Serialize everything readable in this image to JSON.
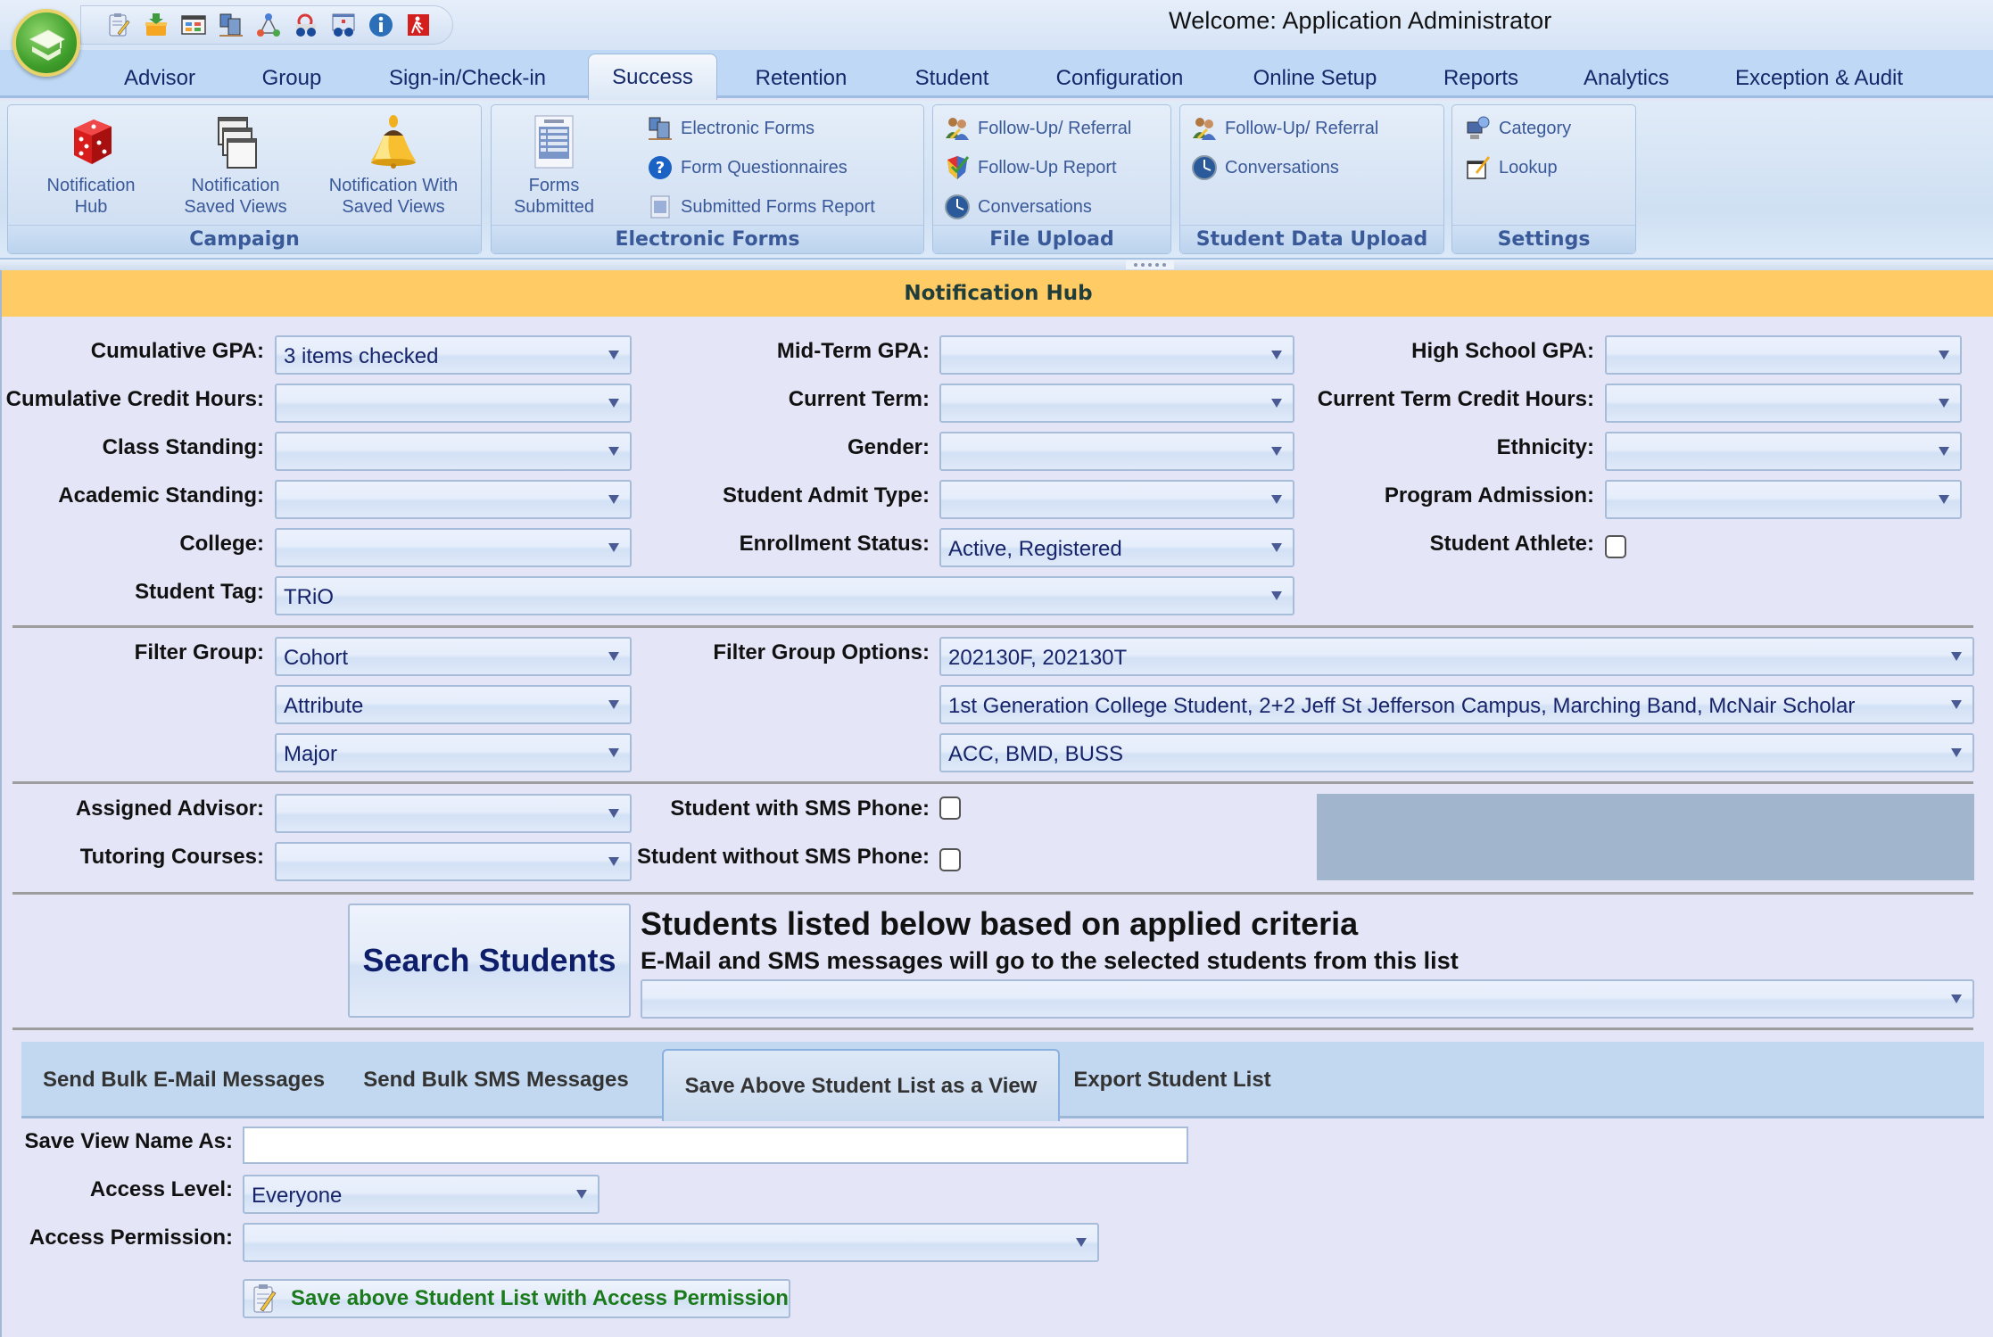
{
  "window": {
    "welcome_text": "Welcome: Application Administrator"
  },
  "quick_access": [
    {
      "icon": "notepad-edit-icon"
    },
    {
      "icon": "basket-download-icon"
    },
    {
      "icon": "dashboard-window-icon"
    },
    {
      "icon": "computer-backup-icon"
    },
    {
      "icon": "network-triangle-icon"
    },
    {
      "icon": "email-binoculars-icon"
    },
    {
      "icon": "table-binoculars-icon"
    },
    {
      "icon": "info-icon"
    },
    {
      "icon": "exit-icon"
    }
  ],
  "ribbon_tabs": [
    {
      "label": "Advisor"
    },
    {
      "label": "Group"
    },
    {
      "label": "Sign-in/Check-in"
    },
    {
      "label": "Success",
      "active": true
    },
    {
      "label": "Retention"
    },
    {
      "label": "Student"
    },
    {
      "label": "Configuration"
    },
    {
      "label": "Online Setup"
    },
    {
      "label": "Reports"
    },
    {
      "label": "Analytics"
    },
    {
      "label": "Exception & Audit"
    }
  ],
  "ribbon_groups": {
    "campaign": {
      "title": "Campaign",
      "buttons": [
        {
          "line1": "Notification",
          "line2": "Hub",
          "icon": "red-dice-icon"
        },
        {
          "line1": "Notification",
          "line2": "Saved Views",
          "icon": "stacked-windows-icon"
        },
        {
          "line1": "Notification With",
          "line2": "Saved Views",
          "icon": "bell-icon"
        }
      ]
    },
    "electronic_forms": {
      "title": "Electronic Forms",
      "big_button": {
        "line1": "Forms",
        "line2": "Submitted",
        "icon": "form-sheet-icon"
      },
      "items": [
        {
          "label": "Electronic Forms",
          "icon": "computer-backup-icon"
        },
        {
          "label": "Form Questionnaires",
          "icon": "help-question-icon"
        },
        {
          "label": "Submitted Forms Report",
          "icon": "report-sheet-icon"
        }
      ]
    },
    "file_upload": {
      "title": "File Upload",
      "items": [
        {
          "label": "Follow-Up/ Referral",
          "icon": "users-referral-icon"
        },
        {
          "label": "Follow-Up Report",
          "icon": "shield-check-icon"
        },
        {
          "label": "Conversations",
          "icon": "clock-icon"
        }
      ]
    },
    "student_data_upload": {
      "title": "Student Data Upload",
      "items": [
        {
          "label": "Follow-Up/ Referral",
          "icon": "users-referral-icon"
        },
        {
          "label": "Conversations",
          "icon": "clock-icon"
        }
      ]
    },
    "settings": {
      "title": "Settings",
      "items": [
        {
          "label": "Category",
          "icon": "category-computer-icon"
        },
        {
          "label": "Lookup",
          "icon": "lookup-edit-icon"
        }
      ]
    }
  },
  "page": {
    "header": "Notification Hub"
  },
  "filters": {
    "cumulative_gpa": {
      "label": "Cumulative GPA:",
      "value": "3 items checked"
    },
    "mid_term_gpa": {
      "label": "Mid-Term GPA:",
      "value": ""
    },
    "high_school_gpa": {
      "label": "High School GPA:",
      "value": ""
    },
    "cumulative_credit_hours": {
      "label": "Cumulative Credit Hours:",
      "value": ""
    },
    "current_term": {
      "label": "Current Term:",
      "value": ""
    },
    "current_term_credit_hours": {
      "label": "Current Term Credit Hours:",
      "value": ""
    },
    "class_standing": {
      "label": "Class Standing:",
      "value": ""
    },
    "gender": {
      "label": "Gender:",
      "value": ""
    },
    "ethnicity": {
      "label": "Ethnicity:",
      "value": ""
    },
    "academic_standing": {
      "label": "Academic Standing:",
      "value": ""
    },
    "student_admit_type": {
      "label": "Student Admit Type:",
      "value": ""
    },
    "program_admission": {
      "label": "Program Admission:",
      "value": ""
    },
    "college": {
      "label": "College:",
      "value": ""
    },
    "enrollment_status": {
      "label": "Enrollment Status:",
      "value": "Active, Registered"
    },
    "student_athlete": {
      "label": "Student Athlete:",
      "checked": false
    },
    "student_tag": {
      "label": "Student Tag:",
      "value": "TRiO"
    }
  },
  "filter_groups": {
    "label": "Filter Group:",
    "options_label": "Filter Group Options:",
    "rows": [
      {
        "group": "Cohort",
        "options": "202130F, 202130T"
      },
      {
        "group": "Attribute",
        "options": "1st Generation College Student, 2+2 Jeff St Jefferson Campus, Marching Band, McNair Scholar"
      },
      {
        "group": "Major",
        "options": "ACC, BMD, BUSS"
      }
    ]
  },
  "advisor_filters": {
    "assigned_advisor": {
      "label": "Assigned Advisor:",
      "value": ""
    },
    "tutoring_courses": {
      "label": "Tutoring Courses:",
      "value": ""
    },
    "with_sms": {
      "label": "Student with SMS Phone:",
      "checked": false
    },
    "without_sms": {
      "label": "Student without SMS Phone:",
      "checked": false
    }
  },
  "search": {
    "button_label": "Search Students",
    "results_title": "Students listed below based on applied criteria",
    "results_subtitle": "E-Mail and SMS messages will go to the selected students from this list",
    "results_value": ""
  },
  "action_tabs": [
    {
      "label": "Send Bulk E-Mail Messages"
    },
    {
      "label": "Send Bulk SMS Messages"
    },
    {
      "label": "Save Above Student List as a View",
      "active": true
    },
    {
      "label": "Export Student List"
    }
  ],
  "save_view": {
    "name_label": "Save View Name As:",
    "name_value": "",
    "access_level_label": "Access Level:",
    "access_level_value": "Everyone",
    "access_permission_label": "Access Permission:",
    "access_permission_value": "",
    "save_button_label": "Save above Student List with Access Permission"
  },
  "colors": {
    "hub_header_bg": "#fecb64",
    "ribbon_text": "#3a5998",
    "save_button_text": "#1b7a1b",
    "content_bg": "#e4e6f7"
  }
}
